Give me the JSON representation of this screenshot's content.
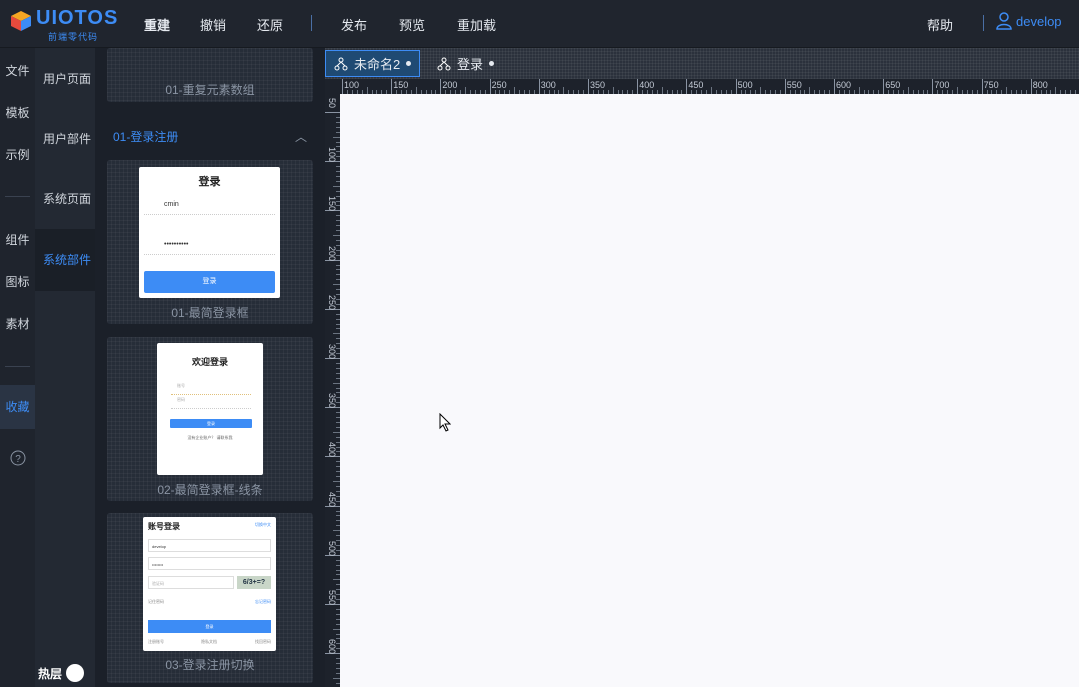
{
  "app": {
    "logo_text": "UIOTOS",
    "logo_sub": "前端零代码"
  },
  "topbar": {
    "menu": [
      "重建",
      "撤销",
      "还原",
      "发布",
      "预览",
      "重加载"
    ],
    "help": "帮助",
    "user": "develop"
  },
  "leftnav": {
    "items": [
      "文件",
      "模板",
      "示例",
      "组件",
      "图标",
      "素材",
      "收藏"
    ],
    "help_icon": "?"
  },
  "subnav": {
    "items": [
      "用户页面",
      "用户部件",
      "系统页面",
      "系统部件"
    ],
    "active": "系统部件",
    "toggle_label": "热层"
  },
  "gallery": {
    "top_caption": "01-重复元素数组",
    "section": "01-登录注册",
    "cards": [
      {
        "caption": "01-最简登录框",
        "title": "登录",
        "username": "cmin",
        "password": "••••••••••",
        "button": "登录"
      },
      {
        "caption": "02-最简登录框-线条",
        "title": "欢迎登录",
        "field1": "账号",
        "field2": "密码",
        "button": "登录",
        "footer": "没有企业账户？ 请联系我"
      },
      {
        "caption": "03-登录注册切换",
        "title": "账号登录",
        "switch": "切换中文",
        "username": "develop",
        "password": "••••••••",
        "captcha_placeholder": "验证码",
        "captcha": "6/3+=?",
        "remember": "记住密码",
        "forgot": "忘记密码",
        "button": "登录",
        "links": [
          "注册账号",
          "隐私文档",
          "找回密码"
        ]
      }
    ]
  },
  "editor": {
    "tabs": [
      {
        "label": "未命名2",
        "active": true
      },
      {
        "label": "登录",
        "active": false
      }
    ],
    "ruler_h": [
      "100",
      "150",
      "200",
      "250",
      "300",
      "350",
      "400",
      "450",
      "500",
      "550",
      "600",
      "650",
      "700",
      "750",
      "800"
    ],
    "ruler_v": [
      "50",
      "100",
      "150",
      "200",
      "250",
      "300",
      "350",
      "400",
      "450",
      "500",
      "550",
      "600"
    ]
  },
  "colors": {
    "accent": "#3d8cf5",
    "bg": "#1d2330",
    "canvas": "#f9f9fc"
  }
}
